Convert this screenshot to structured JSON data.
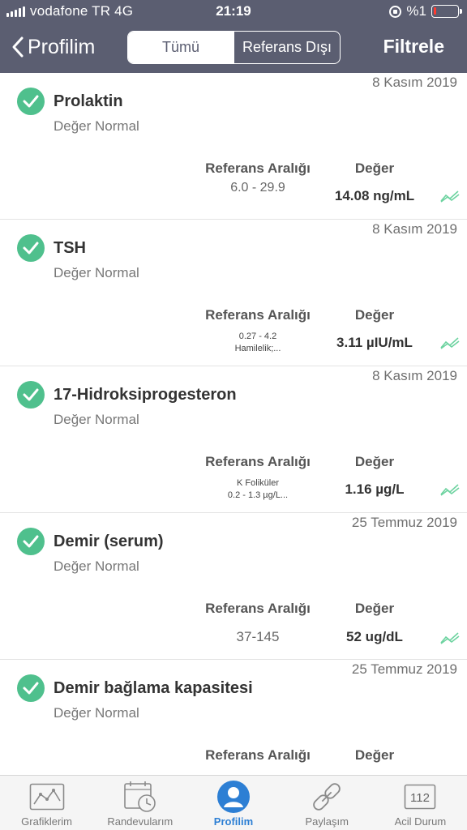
{
  "status_bar": {
    "carrier": "vodafone TR 4G",
    "time": "21:19",
    "battery": "%1"
  },
  "nav": {
    "back_label": "Profilim",
    "segments": [
      "Tümü",
      "Referans Dışı"
    ],
    "active_segment": "Tümü",
    "filter_label": "Filtrele"
  },
  "columns": {
    "reference_header": "Referans Aralığı",
    "value_header": "Değer"
  },
  "results": [
    {
      "date": "8 Kasım 2019",
      "name": "Prolaktin",
      "status": "Değer Normal",
      "reference": "6.0 - 29.9",
      "value": "14.08 ng/mL"
    },
    {
      "date": "8 Kasım 2019",
      "name": "TSH",
      "status": "Değer Normal",
      "reference_line1": "0.27 - 4.2",
      "reference_line2": "Hamilelik;...",
      "value": "3.11 µIU/mL"
    },
    {
      "date": "8 Kasım 2019",
      "name": "17-Hidroksiprogesteron",
      "status": "Değer Normal",
      "reference_line1": "K  Foliküler",
      "reference_line2": "0.2 - 1.3      µg/L...",
      "value": "1.16 µg/L"
    },
    {
      "date": "25 Temmuz 2019",
      "name": "Demir (serum)",
      "status": "Değer Normal",
      "reference": "37-145",
      "value": "52 ug/dL"
    },
    {
      "date": "25 Temmuz 2019",
      "name": "Demir bağlama kapasitesi",
      "status": "Değer Normal"
    }
  ],
  "tabs": [
    {
      "label": "Grafiklerim",
      "icon": "chart-icon"
    },
    {
      "label": "Randevularım",
      "icon": "calendar-clock-icon"
    },
    {
      "label": "Profilim",
      "icon": "profile-icon",
      "active": true
    },
    {
      "label": "Paylaşım",
      "icon": "link-icon"
    },
    {
      "label": "Acil Durum",
      "icon": "emergency-112-icon",
      "badge": "112"
    }
  ],
  "colors": {
    "header_bg": "#5b5e71",
    "check_green": "#4fc08d",
    "active_tab_blue": "#2d7fd4"
  }
}
